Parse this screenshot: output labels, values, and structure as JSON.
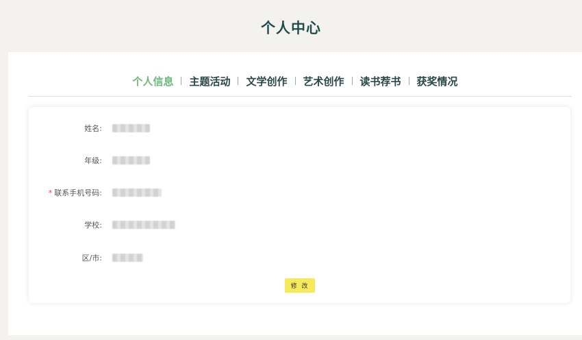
{
  "header": {
    "title": "个人中心"
  },
  "tabs": [
    {
      "label": "个人信息",
      "active": true
    },
    {
      "label": "主题活动",
      "active": false
    },
    {
      "label": "文学创作",
      "active": false
    },
    {
      "label": "艺术创作",
      "active": false
    },
    {
      "label": "读书荐书",
      "active": false
    },
    {
      "label": "获奖情况",
      "active": false
    }
  ],
  "form": {
    "fields": [
      {
        "label": "姓名:",
        "required": false
      },
      {
        "label": "年级:",
        "required": false
      },
      {
        "label": "联系手机号码:",
        "required": true,
        "required_mark": "*"
      },
      {
        "label": "学校:",
        "required": false
      },
      {
        "label": "区/市:",
        "required": false
      }
    ],
    "submit_label": "修 改"
  },
  "colors": {
    "title": "#1f4d4a",
    "tab_active": "#6fba7a",
    "tab_default": "#2a4747",
    "required": "#e0483f",
    "button": "#f7e95c"
  }
}
